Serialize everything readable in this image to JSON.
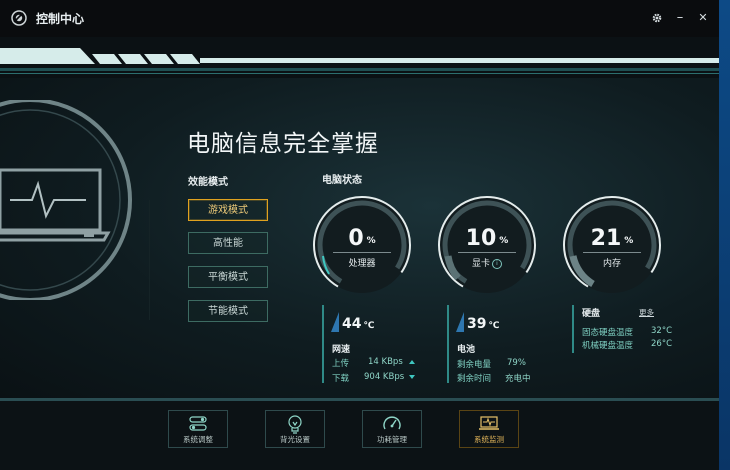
{
  "window": {
    "title": "控制中心"
  },
  "titlebar_icons": {
    "settings": "gear-icon",
    "minimize": "minimize-icon",
    "close": "close-icon",
    "minimize_glyph": "–",
    "close_glyph": "✕"
  },
  "hero": {
    "heading": "电脑信息完全掌握"
  },
  "performance": {
    "label": "效能模式",
    "modes": [
      {
        "label": "游戏模式",
        "active": true
      },
      {
        "label": "高性能",
        "active": false
      },
      {
        "label": "平衡模式",
        "active": false
      },
      {
        "label": "节能模式",
        "active": false
      }
    ]
  },
  "status": {
    "label": "电脑状态",
    "gauges": [
      {
        "value": "0",
        "unit": "%",
        "label": "处理器"
      },
      {
        "value": "10",
        "unit": "%",
        "label": "显卡",
        "info_icon": "i"
      },
      {
        "value": "21",
        "unit": "%",
        "label": "内存"
      }
    ],
    "cpu_temp": {
      "value": "44",
      "unit": "℃"
    },
    "gpu_temp": {
      "value": "39",
      "unit": "℃"
    },
    "network": {
      "label": "网速",
      "upload_label": "上传",
      "upload_value": "14 KBps",
      "download_label": "下载",
      "download_value": "904 KBps"
    },
    "battery": {
      "label": "电池",
      "remaining_label": "剩余电量",
      "remaining_value": "79%",
      "time_label": "剩余时间",
      "time_value": "充电中"
    },
    "disk": {
      "label": "硬盘",
      "more": "更多",
      "ssd_label": "固态硬盘温度",
      "ssd_value": "32°C",
      "hdd_label": "机械硬盘温度",
      "hdd_value": "26°C"
    }
  },
  "bottom_nav": [
    {
      "label": "系统调整",
      "icon": "toggle-switches-icon",
      "active": false
    },
    {
      "label": "背光设置",
      "icon": "lightbulb-icon",
      "active": false
    },
    {
      "label": "功耗管理",
      "icon": "speedometer-icon",
      "active": false
    },
    {
      "label": "系统监测",
      "icon": "laptop-monitor-icon",
      "active": true
    }
  ],
  "colors": {
    "accent_active": "#e0a21f",
    "teal": "#3fc7c0",
    "background": "#0b1114",
    "desktop": "#0a3a6e"
  }
}
